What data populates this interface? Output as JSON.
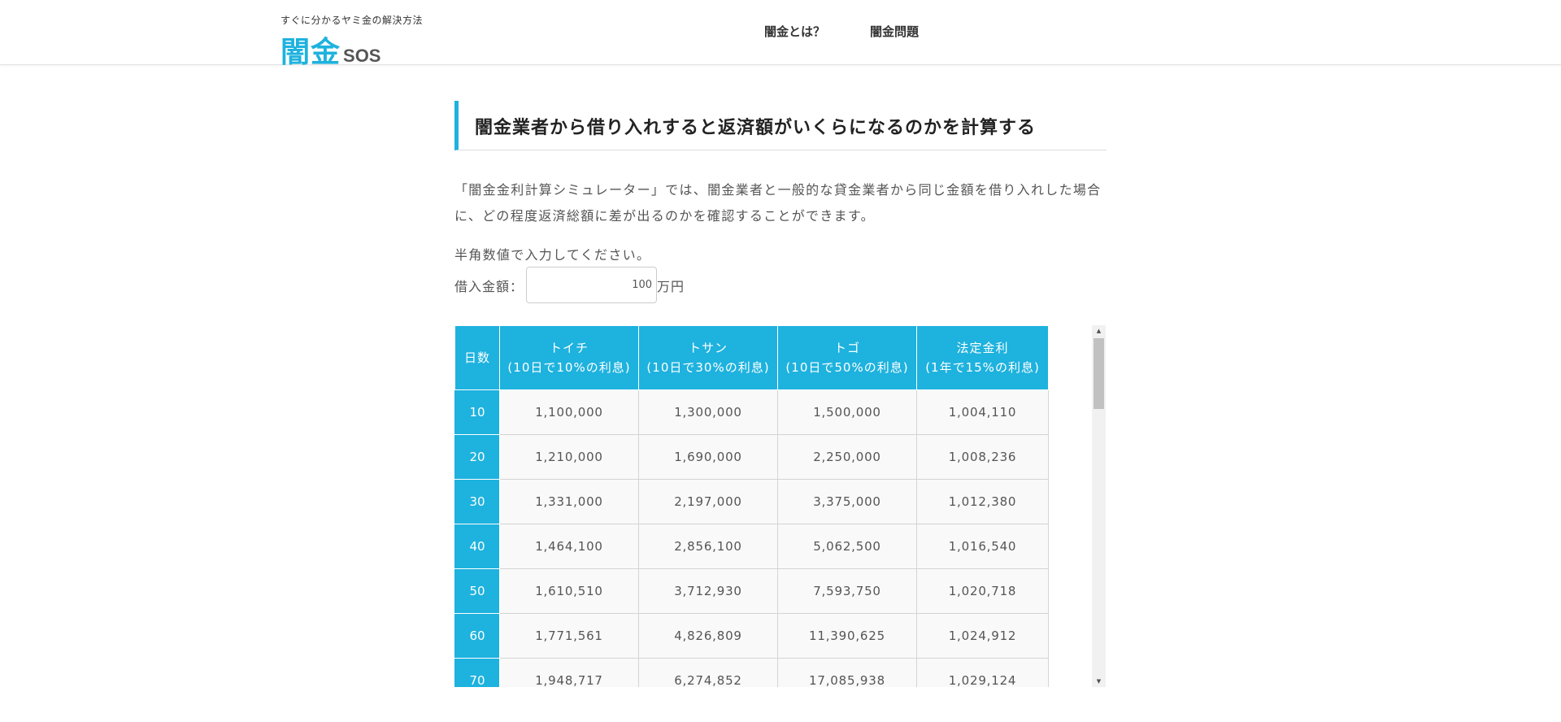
{
  "header": {
    "tagline": "すぐに分かるヤミ金の解決方法",
    "logo_kanji": "闇金",
    "logo_sos": "SOS",
    "nav": [
      {
        "label": "闇金とは？"
      },
      {
        "label": "闇金問題"
      }
    ]
  },
  "main": {
    "heading": "闇金業者から借り入れすると返済額がいくらになるのかを計算する",
    "intro": "「闇金金利計算シミュレーター」では、闇金業者と一般的な貸金業者から同じ金額を借り入れした場合に、どの程度返済総額に差が出るのかを確認することができます。",
    "instruction": "半角数値で入力してください。",
    "amount_label": "借入金額：",
    "amount_value": "100",
    "amount_unit": "万円"
  },
  "table": {
    "headers": {
      "days": "日数",
      "cols": [
        {
          "name": "トイチ",
          "note": "(10日で10%の利息)"
        },
        {
          "name": "トサン",
          "note": "(10日で30%の利息)"
        },
        {
          "name": "トゴ",
          "note": "(10日で50%の利息)"
        },
        {
          "name": "法定金利",
          "note": "(1年で15%の利息)"
        }
      ]
    },
    "rows": [
      {
        "days": "10",
        "values": [
          "1,100,000",
          "1,300,000",
          "1,500,000",
          "1,004,110"
        ]
      },
      {
        "days": "20",
        "values": [
          "1,210,000",
          "1,690,000",
          "2,250,000",
          "1,008,236"
        ]
      },
      {
        "days": "30",
        "values": [
          "1,331,000",
          "2,197,000",
          "3,375,000",
          "1,012,380"
        ]
      },
      {
        "days": "40",
        "values": [
          "1,464,100",
          "2,856,100",
          "5,062,500",
          "1,016,540"
        ]
      },
      {
        "days": "50",
        "values": [
          "1,610,510",
          "3,712,930",
          "7,593,750",
          "1,020,718"
        ]
      },
      {
        "days": "60",
        "values": [
          "1,771,561",
          "4,826,809",
          "11,390,625",
          "1,024,912"
        ]
      },
      {
        "days": "70",
        "values": [
          "1,948,717",
          "6,274,852",
          "17,085,938",
          "1,029,124"
        ]
      }
    ]
  },
  "scrollbar": {
    "up_icon": "▲",
    "down_icon": "▼"
  }
}
